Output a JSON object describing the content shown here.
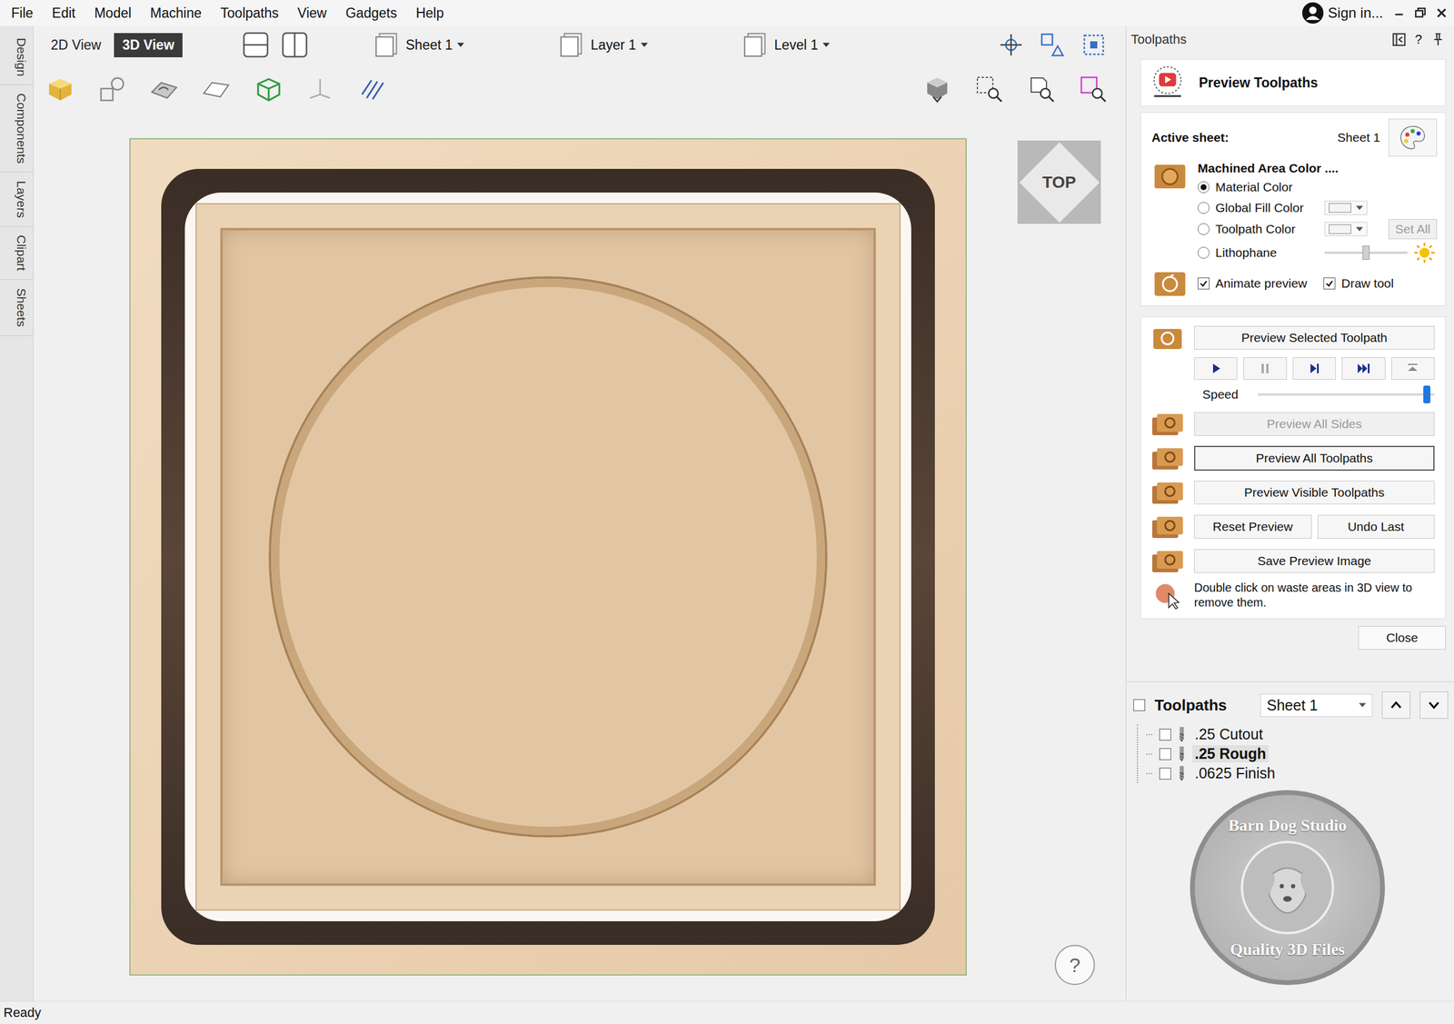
{
  "menu": [
    "File",
    "Edit",
    "Model",
    "Machine",
    "Toolpaths",
    "View",
    "Gadgets",
    "Help"
  ],
  "account": "Sign in...",
  "side_tabs": [
    "Design",
    "Components",
    "Layers",
    "Clipart",
    "Sheets"
  ],
  "view_tabs": [
    {
      "label": "2D View",
      "selected": false
    },
    {
      "label": "3D View",
      "selected": true
    }
  ],
  "selectors": [
    {
      "label": "Sheet 1"
    },
    {
      "label": "Layer 1"
    },
    {
      "label": "Level 1"
    }
  ],
  "view_cube": "TOP",
  "help": "?",
  "status": "Ready",
  "panel": {
    "title": "Toolpaths",
    "help": "?",
    "preview_title": "Preview Toolpaths",
    "active_sheet_label": "Active sheet:",
    "active_sheet": "Sheet 1",
    "machined_area_label": "Machined Area Color ....",
    "color_options": [
      {
        "label": "Material Color",
        "selected": true,
        "kind": "plain",
        "level": 0
      },
      {
        "label": "Global Fill Color",
        "selected": false,
        "kind": "swatch",
        "level": 0
      },
      {
        "label": "Toolpath Color",
        "selected": false,
        "kind": "swatch-setall",
        "level": 0
      },
      {
        "label": "Lithophane",
        "selected": false,
        "kind": "slider",
        "level": 0.5
      }
    ],
    "set_all": {
      "label": "Set All",
      "disabled": true
    },
    "checks": [
      {
        "label": "Animate preview",
        "checked": true
      },
      {
        "label": "Draw tool",
        "checked": true
      }
    ],
    "preview_selected": "Preview Selected Toolpath",
    "playback": [
      {
        "kind": "play",
        "disabled": false
      },
      {
        "kind": "pause",
        "disabled": true
      },
      {
        "kind": "step",
        "disabled": false
      },
      {
        "kind": "end",
        "disabled": false
      },
      {
        "kind": "top",
        "disabled": false
      }
    ],
    "speed": {
      "label": "Speed",
      "level": 0.97
    },
    "rows": [
      {
        "buttons": [
          {
            "label": "Preview All Sides",
            "disabled": true,
            "focused": false
          }
        ]
      },
      {
        "buttons": [
          {
            "label": "Preview All Toolpaths",
            "disabled": false,
            "focused": true
          }
        ]
      },
      {
        "buttons": [
          {
            "label": "Preview Visible Toolpaths",
            "disabled": false,
            "focused": false
          }
        ]
      },
      {
        "buttons": [
          {
            "label": "Reset Preview",
            "disabled": false,
            "focused": false
          },
          {
            "label": "Undo Last",
            "disabled": false,
            "focused": false
          }
        ]
      },
      {
        "buttons": [
          {
            "label": "Save Preview Image",
            "disabled": false,
            "focused": false
          }
        ]
      }
    ],
    "hint": "Double click on waste areas in 3D view to remove them.",
    "close": "Close"
  },
  "toolpaths": {
    "title": "Toolpaths",
    "checked": false,
    "sheet": "Sheet 1",
    "items": [
      {
        "name": ".25 Cutout",
        "checked": false,
        "selected": false
      },
      {
        "name": ".25 Rough",
        "checked": false,
        "selected": true
      },
      {
        "name": ".0625 Finish",
        "checked": false,
        "selected": false
      }
    ]
  },
  "watermark": {
    "top": "Barn Dog Studio",
    "bottom": "Quality 3D Files"
  }
}
